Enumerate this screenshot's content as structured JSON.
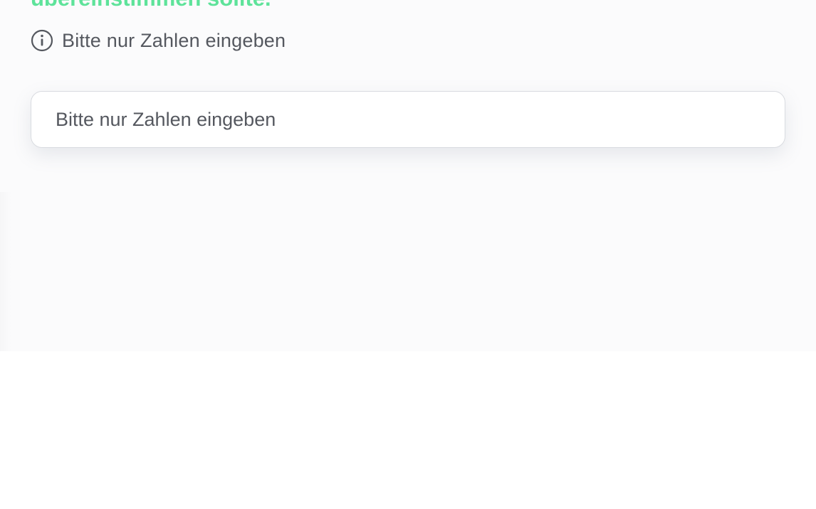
{
  "question": {
    "tail_text": "übereinstimmen sollte."
  },
  "hint": {
    "icon": "info-icon",
    "text": "Bitte nur Zahlen eingeben"
  },
  "answer_input": {
    "value": "",
    "placeholder": "Bitte nur Zahlen eingeben"
  },
  "colors": {
    "accent_green": "#5ee39a",
    "text_gray": "#55585f",
    "card_background": "#fbfbfc",
    "input_border": "#d9dbe0"
  }
}
